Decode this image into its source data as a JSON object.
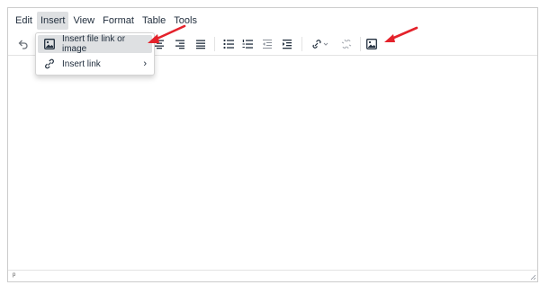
{
  "menubar": {
    "items": [
      "Edit",
      "Insert",
      "View",
      "Format",
      "Table",
      "Tools"
    ],
    "active": "Insert"
  },
  "dropdown": {
    "items": [
      {
        "label": "Insert file link or image",
        "icon": "image-icon"
      },
      {
        "label": "Insert link",
        "icon": "link-icon",
        "submenu": true
      }
    ]
  },
  "statusbar": {
    "path": "p"
  },
  "colors": {
    "accent": "#e4222b",
    "highlight": "#dee0e2",
    "border": "#cccccc"
  }
}
